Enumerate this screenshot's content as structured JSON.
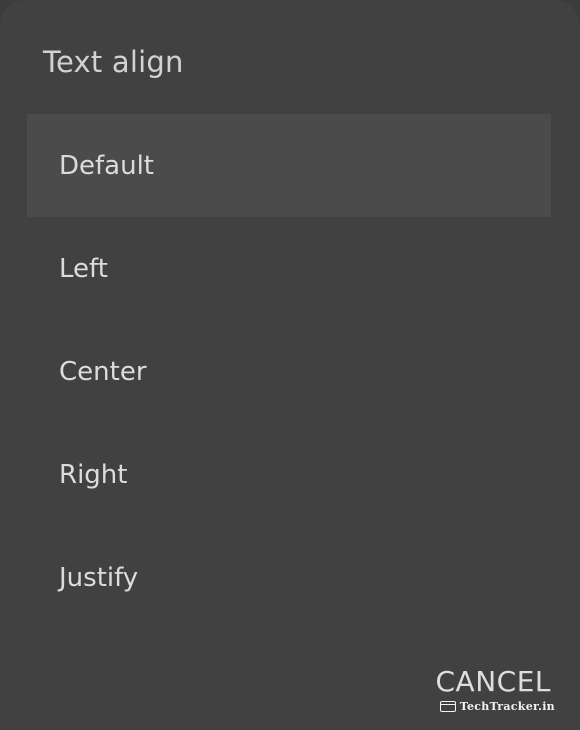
{
  "dialog": {
    "title": "Text align",
    "selected_option": "Default",
    "options": [
      {
        "label": "Default"
      },
      {
        "label": "Left"
      },
      {
        "label": "Center"
      },
      {
        "label": "Right"
      },
      {
        "label": "Justify"
      }
    ],
    "cancel_label": "CANCEL"
  },
  "watermark": {
    "text": "TechTracker.in",
    "icon": "browser-window-icon"
  },
  "colors": {
    "dialog_background": "#414141",
    "selected_row_background": "#4b4b4b",
    "text": "#dcdcdc"
  }
}
